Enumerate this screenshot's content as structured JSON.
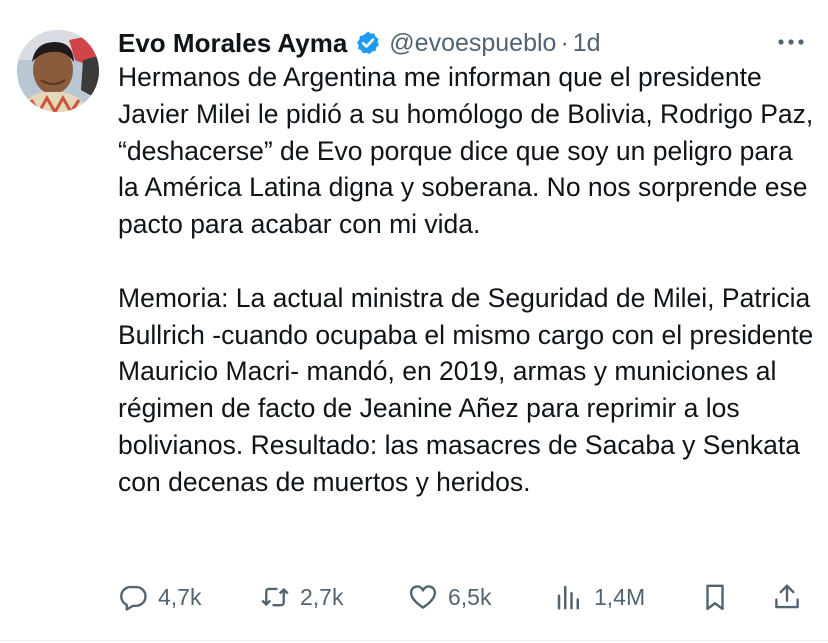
{
  "tweet": {
    "author": {
      "name": "Evo Morales Ayma",
      "handle": "@evoespueblo",
      "separator": "·",
      "time": "1d"
    },
    "paragraphs": [
      "Hermanos de Argentina me informan que el presidente Javier Milei le pidió a su homólogo de Bolivia, Rodrigo Paz, “deshacerse” de Evo porque dice que soy un peligro para la América Latina digna y soberana. No nos sorprende ese pacto para acabar con mi vida.",
      "Memoria: La actual ministra de Seguridad de Milei, Patricia Bullrich -cuando ocupaba el mismo cargo con el presidente Mauricio Macri- mandó, en 2019, armas y municiones al régimen de facto de Jeanine Añez para reprimir a los bolivianos. Resultado: las masacres de Sacaba y Senkata con decenas de muertos y heridos."
    ],
    "actions": {
      "replies": "4,7k",
      "reposts": "2,7k",
      "likes": "6,5k",
      "views": "1,4M"
    }
  },
  "icons": {
    "verified": "verified-badge-icon",
    "more": "more-options-icon",
    "reply": "reply-bubble-icon",
    "repost": "repost-arrows-icon",
    "like": "heart-icon",
    "views": "bar-chart-icon",
    "bookmark": "bookmark-icon",
    "share": "share-upload-icon"
  },
  "colors": {
    "text": "#0f1419",
    "secondary": "#536471",
    "verified": "#1d9bf0"
  }
}
